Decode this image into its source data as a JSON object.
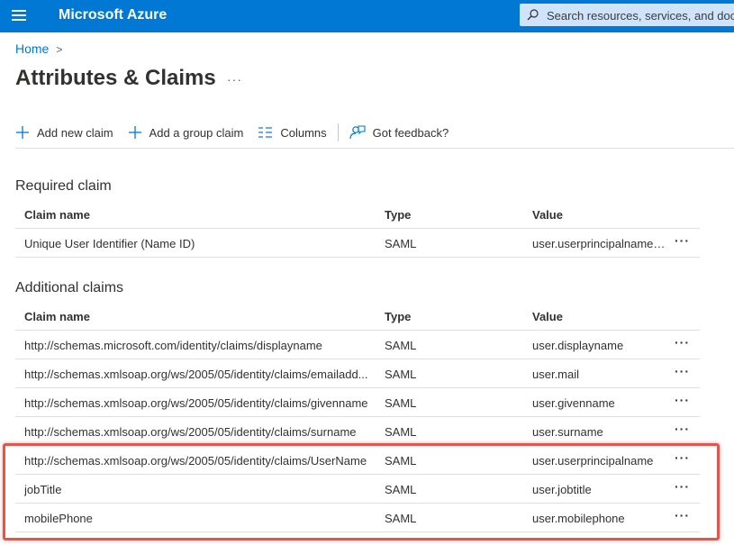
{
  "app": {
    "brand": "Microsoft Azure"
  },
  "search": {
    "placeholder": "Search resources, services, and docs"
  },
  "breadcrumb": {
    "home": "Home",
    "separator": ">"
  },
  "page": {
    "title": "Attributes & Claims",
    "more": "···"
  },
  "toolbar": {
    "add_new_claim": "Add new claim",
    "add_group_claim": "Add a group claim",
    "columns": "Columns",
    "feedback": "Got feedback?"
  },
  "columns": {
    "name": "Claim name",
    "type": "Type",
    "value": "Value"
  },
  "required": {
    "title": "Required claim",
    "rows": [
      {
        "name": "Unique User Identifier (Name ID)",
        "type": "SAML",
        "value": "user.userprincipalname [..."
      }
    ]
  },
  "additional": {
    "title": "Additional claims",
    "rows": [
      {
        "name": "http://schemas.microsoft.com/identity/claims/displayname",
        "type": "SAML",
        "value": "user.displayname"
      },
      {
        "name": "http://schemas.xmlsoap.org/ws/2005/05/identity/claims/emailadd...",
        "type": "SAML",
        "value": "user.mail"
      },
      {
        "name": "http://schemas.xmlsoap.org/ws/2005/05/identity/claims/givenname",
        "type": "SAML",
        "value": "user.givenname"
      },
      {
        "name": "http://schemas.xmlsoap.org/ws/2005/05/identity/claims/surname",
        "type": "SAML",
        "value": "user.surname"
      },
      {
        "name": "http://schemas.xmlsoap.org/ws/2005/05/identity/claims/UserName",
        "type": "SAML",
        "value": "user.userprincipalname"
      },
      {
        "name": "jobTitle",
        "type": "SAML",
        "value": "user.jobtitle"
      },
      {
        "name": "mobilePhone",
        "type": "SAML",
        "value": "user.mobilephone"
      }
    ]
  },
  "row_more": "···",
  "colors": {
    "accent": "#0078d4",
    "highlight": "#e8534a"
  }
}
